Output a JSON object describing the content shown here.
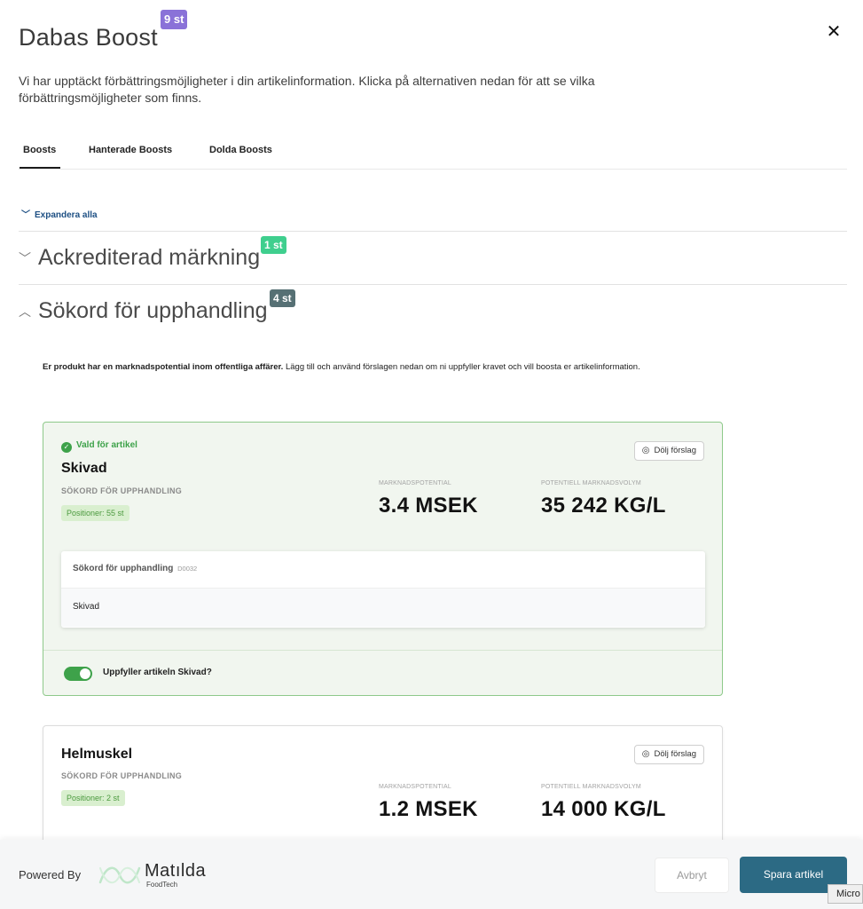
{
  "dialog": {
    "title": "Dabas Boost",
    "total_badge": "9 st",
    "intro": "Vi har upptäckt förbättringsmöjligheter i din artikelinformation. Klicka på alternativen nedan för att se vilka förbättringsmöjligheter som finns."
  },
  "tabs": [
    {
      "label": "Boosts",
      "active": true
    },
    {
      "label": "Hanterade Boosts",
      "active": false
    },
    {
      "label": "Dolda Boosts",
      "active": false
    }
  ],
  "expand_all": "Expandera alla",
  "sections": [
    {
      "title": "Ackrediterad märkning",
      "badge": "1 st",
      "expanded": false
    },
    {
      "title": "Sökord för upphandling",
      "badge": "4 st",
      "expanded": true
    }
  ],
  "section_desc": {
    "bold": "Er produkt har en marknadspotential inom offentliga affärer.",
    "rest": " Lägg till och använd förslagen nedan om ni uppfyller kravet och vill boosta er artikelinformation."
  },
  "cards": [
    {
      "status": "Vald för artikel",
      "name": "Skivad",
      "type": "SÖKORD FÖR UPPHANDLING",
      "positions": "Positioner: 55 st",
      "hide_label": "Dölj förslag",
      "market_potential_label": "MARKNADSPOTENTIAL",
      "market_potential_value": "3.4 MSEK",
      "market_volume_label": "POTENTIELL MARKNADSVOLYM",
      "market_volume_value": "35 242 KG/L",
      "field_title": "Sökord för upphandling",
      "field_code": "D0032",
      "field_value": "Skivad",
      "question": "Uppfyller artikeln Skivad?",
      "toggle_on": true
    },
    {
      "name": "Helmuskel",
      "type": "SÖKORD FÖR UPPHANDLING",
      "positions": "Positioner: 2 st",
      "hide_label": "Dölj förslag",
      "market_potential_label": "MARKNADSPOTENTIAL",
      "market_potential_value": "1.2 MSEK",
      "market_volume_label": "POTENTIELL MARKNADSVOLYM",
      "market_volume_value": "14 000 KG/L"
    }
  ],
  "footer": {
    "powered_by": "Powered By",
    "logo_name": "Matılda",
    "logo_sub": "FoodTech",
    "cancel_label": "Avbryt",
    "save_label": "Spara artikel"
  },
  "tooltip": "Micro",
  "colors": {
    "accent_purple": "#8a72d8",
    "badge_green": "#3fcf8e",
    "badge_teal": "#567074",
    "selected_green": "#3ea24a",
    "save_button": "#2c6a84",
    "link_blue": "#1d4f83"
  }
}
